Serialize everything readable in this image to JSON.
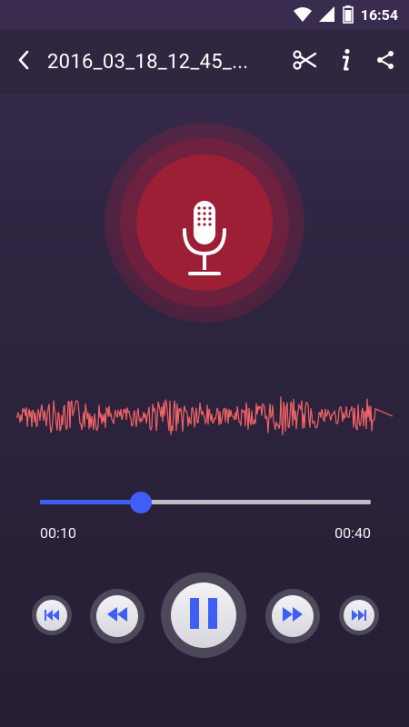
{
  "status_bar": {
    "time": "16:54",
    "icons": [
      "wifi-icon",
      "signal-icon",
      "battery-icon"
    ]
  },
  "app_bar": {
    "back_icon": "chevron-left-icon",
    "title": "2016_03_18_12_45_...",
    "actions": [
      {
        "name": "trim",
        "icon": "scissors-icon"
      },
      {
        "name": "info",
        "icon": "info-icon"
      },
      {
        "name": "share",
        "icon": "share-icon"
      }
    ]
  },
  "visual": {
    "mic_icon": "microphone-icon",
    "waveform_color": "#f06366"
  },
  "player": {
    "current_time": "00:10",
    "total_time": "00:40",
    "progress": 0.305,
    "accent_color": "#3f5ef5",
    "controls": [
      {
        "name": "skip-previous",
        "icon": "skip-previous-icon"
      },
      {
        "name": "rewind",
        "icon": "rewind-icon"
      },
      {
        "name": "pause",
        "icon": "pause-icon"
      },
      {
        "name": "fast-forward",
        "icon": "fast-forward-icon"
      },
      {
        "name": "skip-next",
        "icon": "skip-next-icon"
      }
    ]
  }
}
